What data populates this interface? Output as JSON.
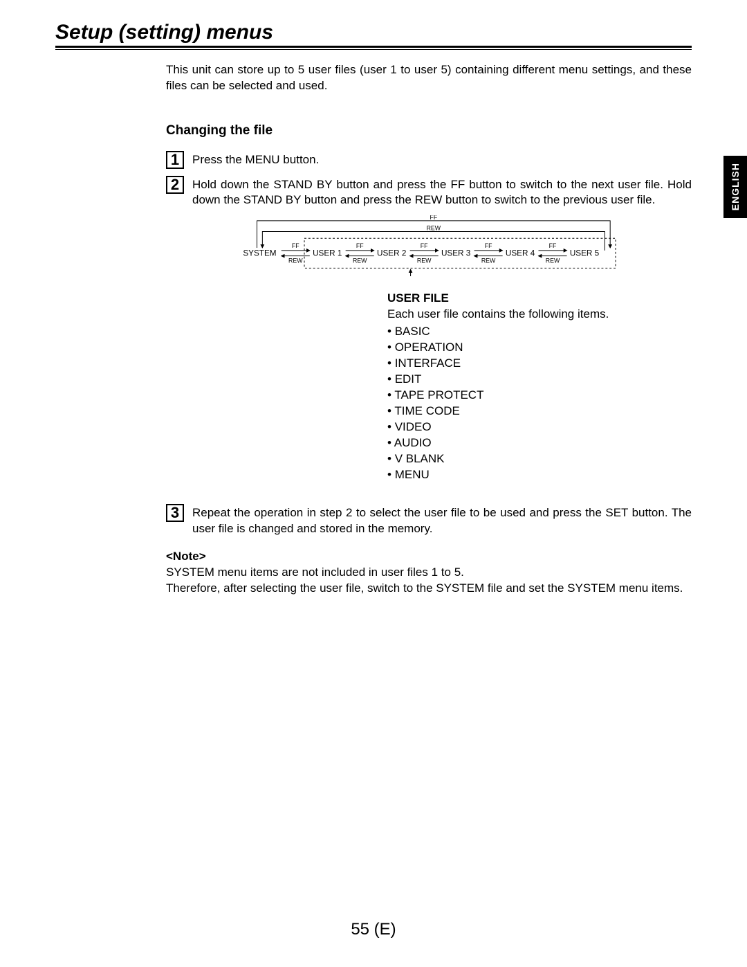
{
  "title": "Setup (setting) menus",
  "side_tab": "ENGLISH",
  "intro": "This unit can store up to 5 user files (user 1 to user 5) containing different menu settings, and these files can be selected and used.",
  "subhead": "Changing the file",
  "steps": {
    "s1": {
      "num": "1",
      "text": "Press the MENU button."
    },
    "s2": {
      "num": "2",
      "text": "Hold down the STAND BY button and press the FF button to switch to the next user file. Hold down the STAND BY button and press the REW button to switch to the previous user file."
    },
    "s3": {
      "num": "3",
      "text": "Repeat the operation in step 2 to select the user file to be used and press the SET button. The user file is changed and stored in the memory."
    }
  },
  "diagram": {
    "nodes": [
      "SYSTEM",
      "USER 1",
      "USER 2",
      "USER 3",
      "USER 4",
      "USER 5"
    ],
    "ff": "FF",
    "rew": "REW"
  },
  "user_file": {
    "title": "USER FILE",
    "desc": "Each user file contains the following items.",
    "items": [
      "BASIC",
      "OPERATION",
      "INTERFACE",
      "EDIT",
      "TAPE PROTECT",
      "TIME CODE",
      "VIDEO",
      "AUDIO",
      "V BLANK",
      "MENU"
    ]
  },
  "note": {
    "title": "<Note>",
    "line1": "SYSTEM menu items are not included in user files 1 to 5.",
    "line2": "Therefore, after selecting the user file, switch to the SYSTEM file and set the SYSTEM menu items."
  },
  "page_number": "55 (E)"
}
